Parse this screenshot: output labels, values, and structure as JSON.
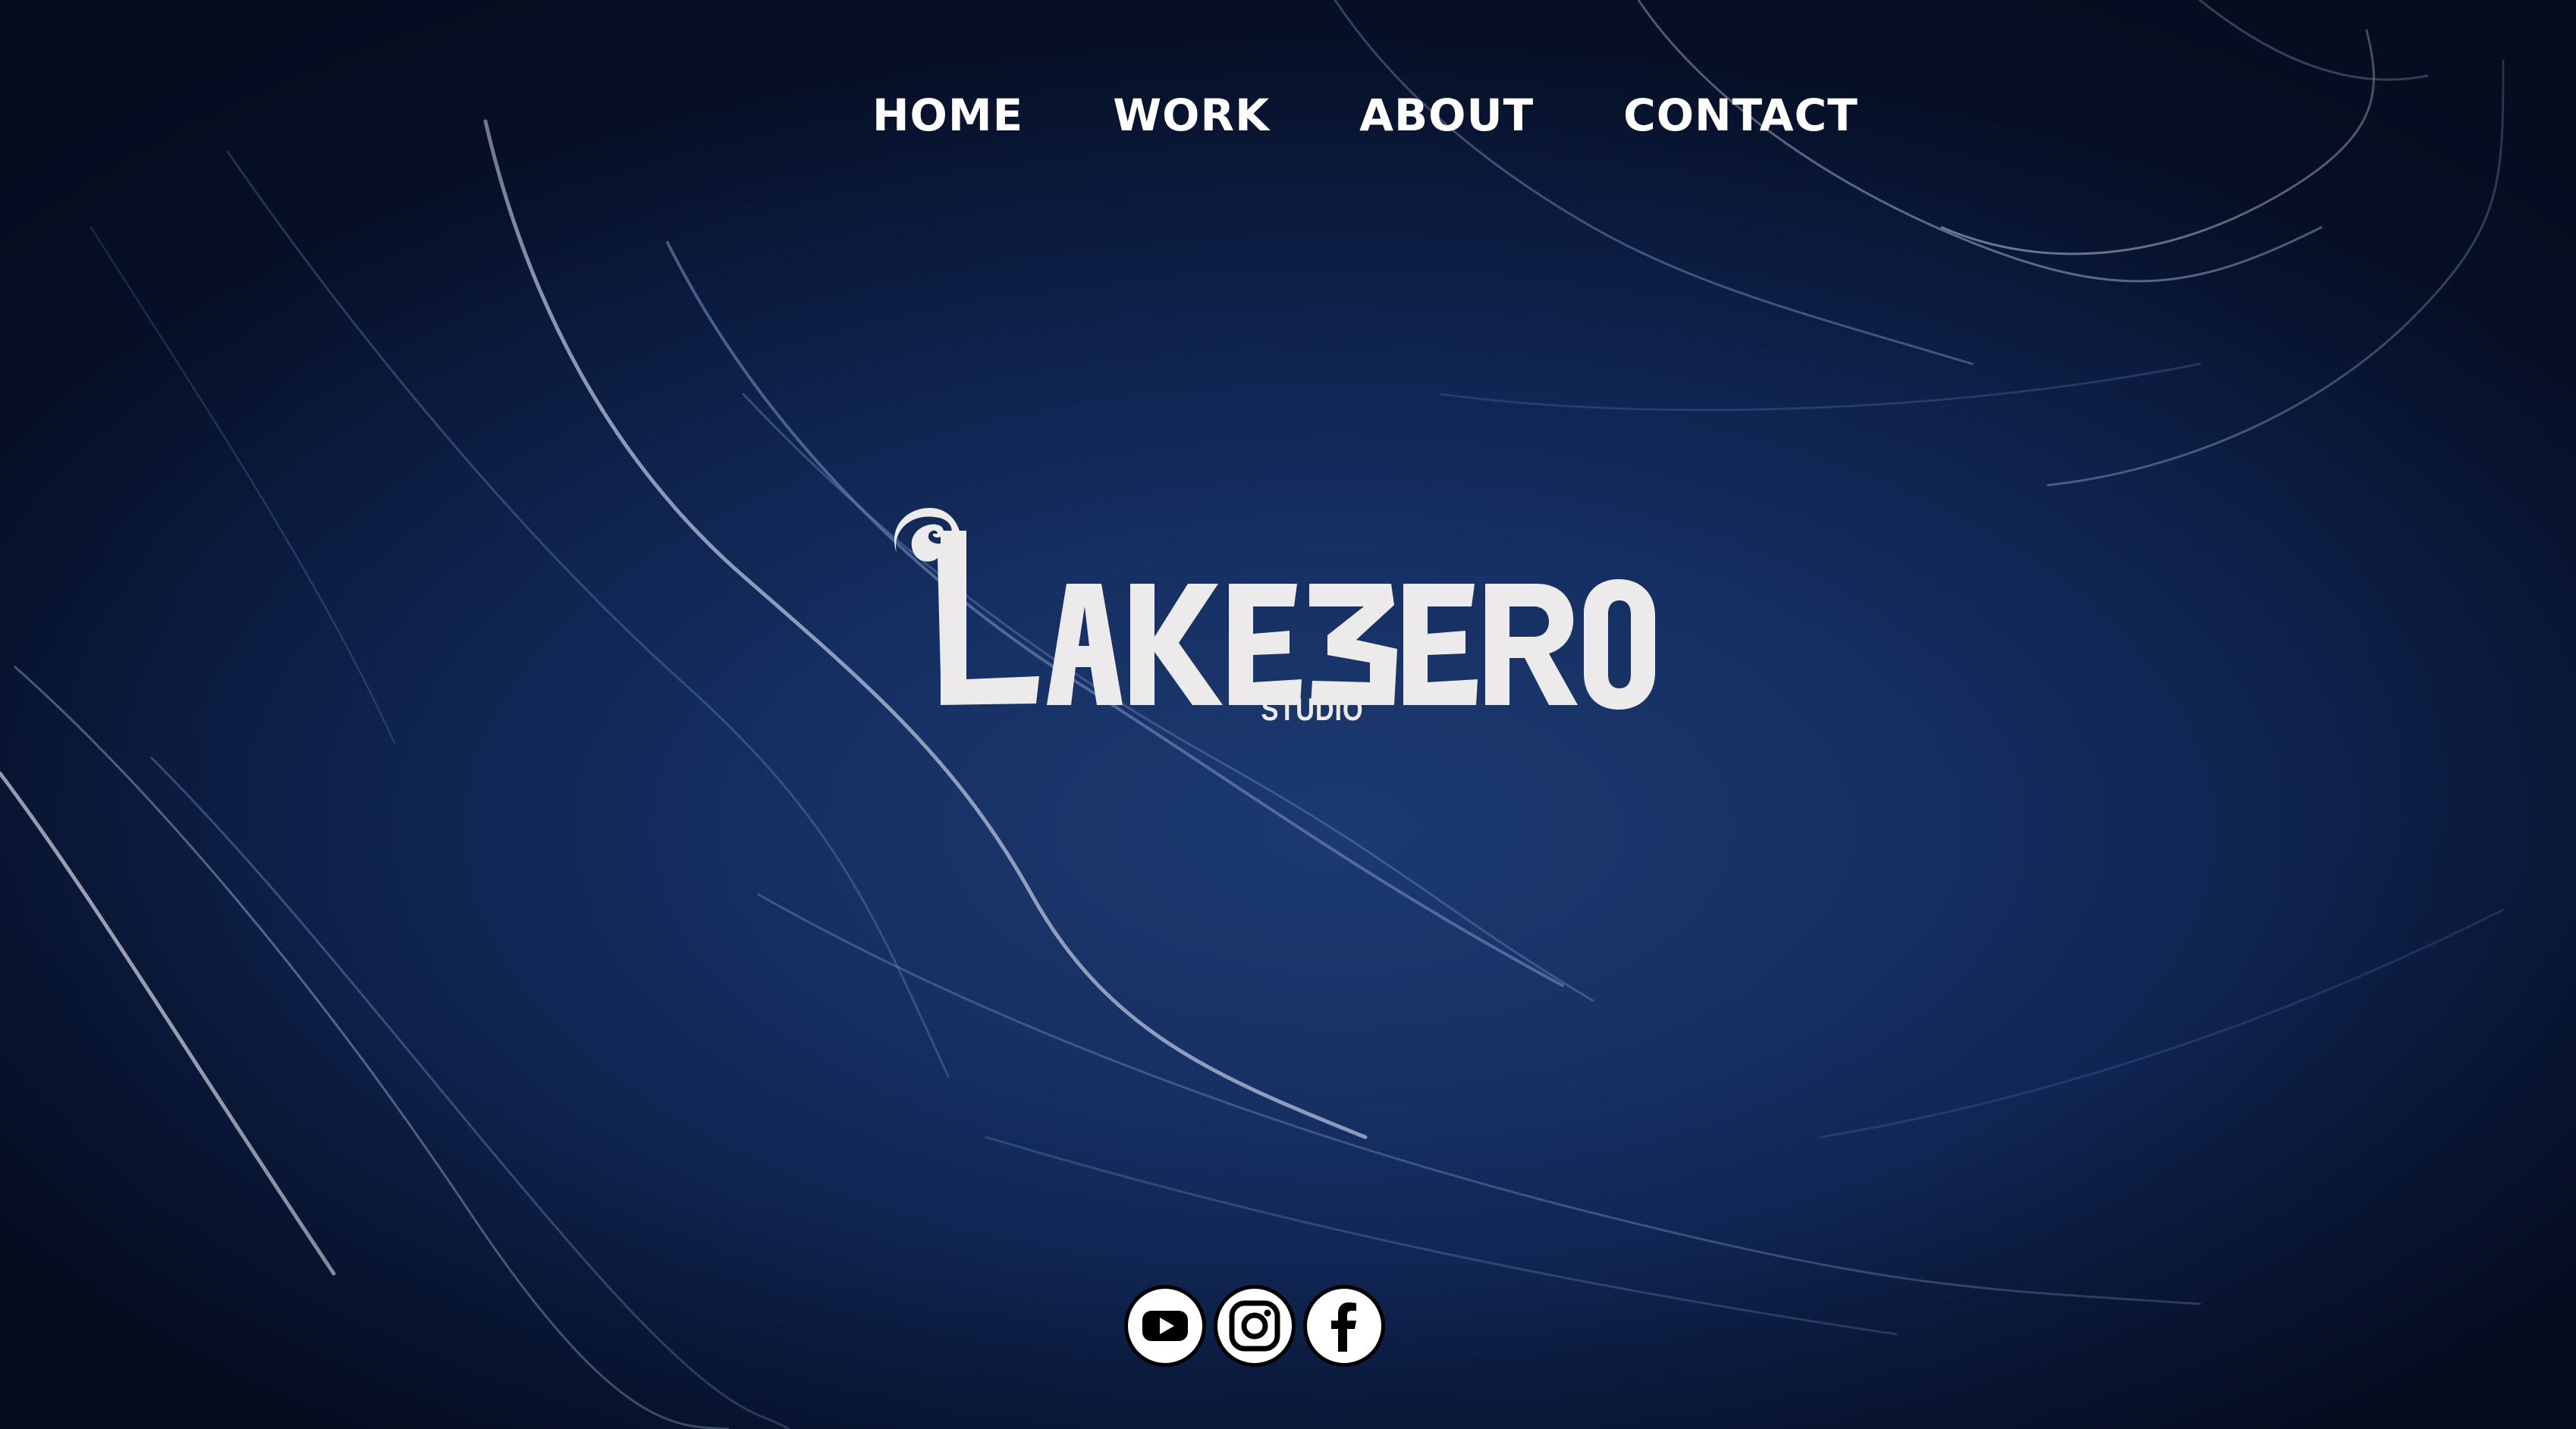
{
  "nav": {
    "items": [
      {
        "label": "HOME"
      },
      {
        "label": "WORK"
      },
      {
        "label": "ABOUT"
      },
      {
        "label": "CONTACT"
      }
    ]
  },
  "brand": {
    "name": "LAKEZERO",
    "subtitle": "STUDIO"
  },
  "social": {
    "items": [
      {
        "icon": "youtube-icon"
      },
      {
        "icon": "instagram-icon"
      },
      {
        "icon": "facebook-icon"
      }
    ]
  },
  "colors": {
    "background": "#122c5c",
    "text": "#ffffff",
    "logo": "#eceaeb"
  }
}
